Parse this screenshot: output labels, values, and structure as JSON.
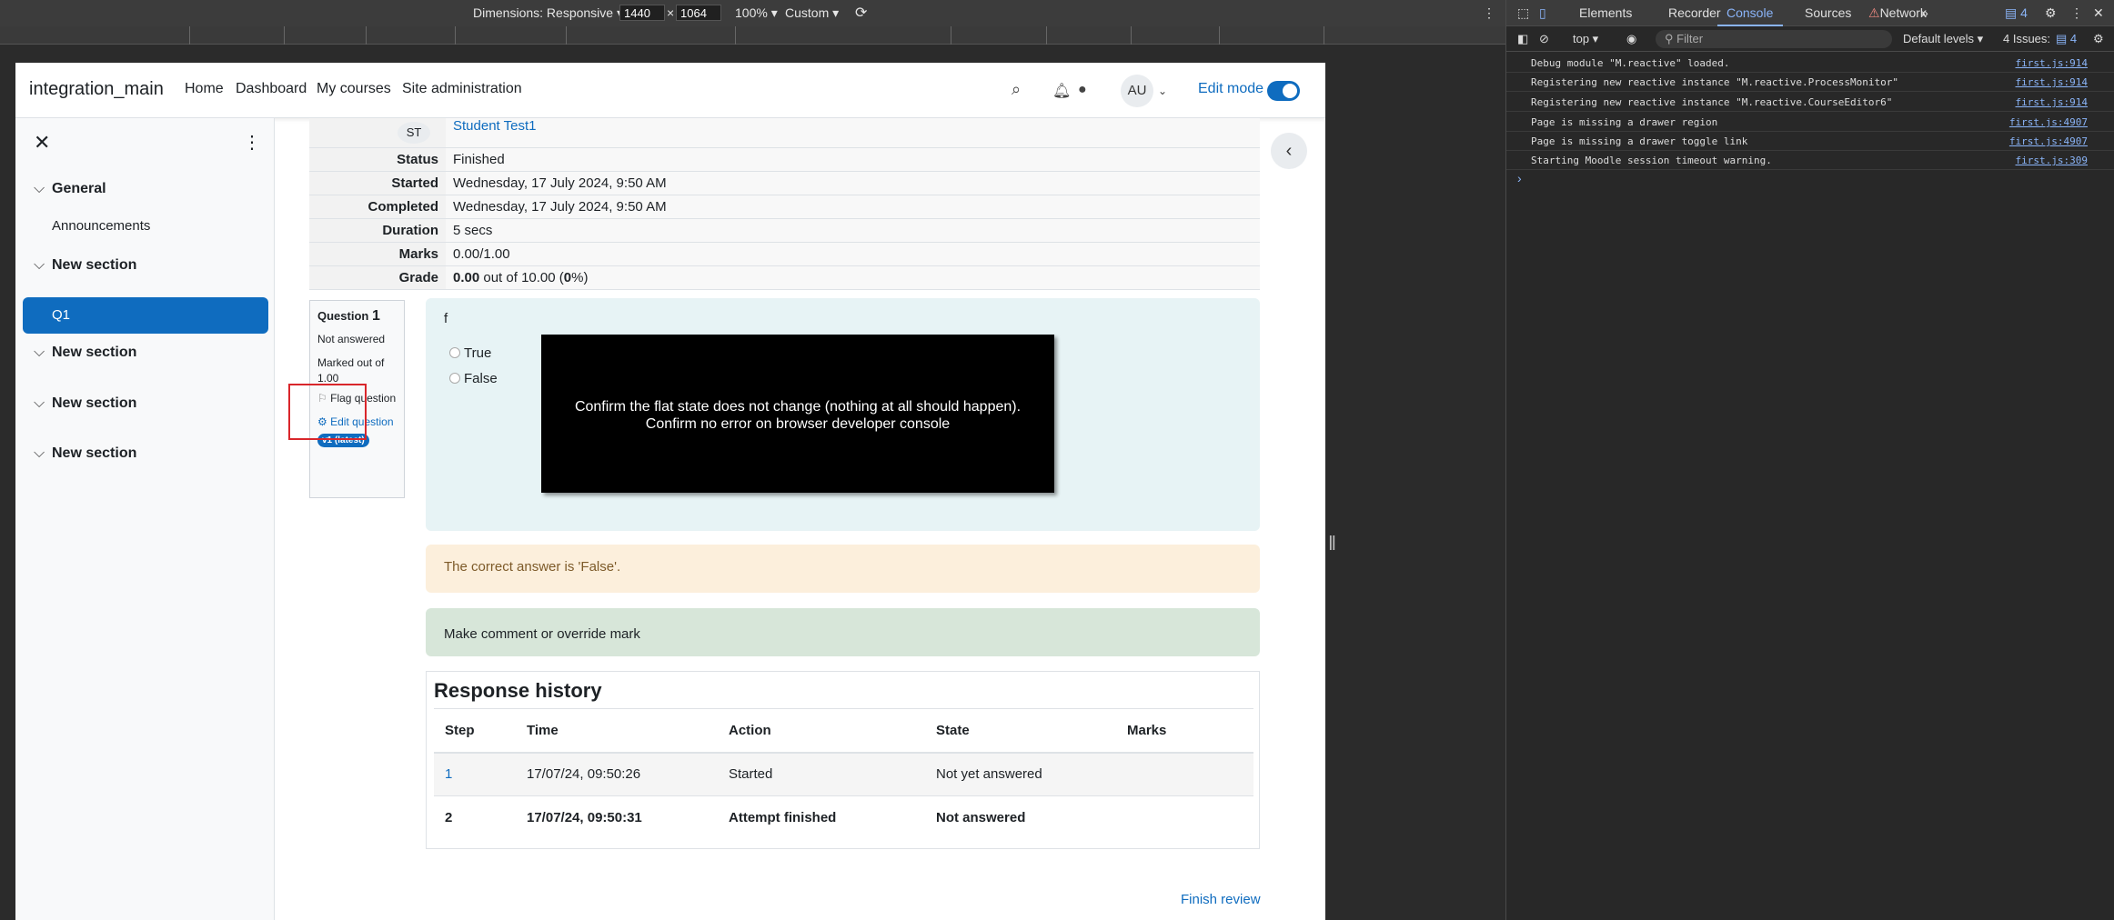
{
  "devtools_device_bar": {
    "dimensions_label": "Dimensions: Responsive ▾",
    "width_value": "1440",
    "times": "×",
    "height_value": "1064",
    "zoom": "100% ▾",
    "throttle": "Custom ▾"
  },
  "navbar": {
    "brand": "integration_main",
    "links": [
      "Home",
      "Dashboard",
      "My courses",
      "Site administration"
    ],
    "avatar_initials": "AU",
    "edit_mode_label": "Edit mode"
  },
  "drawer": {
    "sections": [
      {
        "label": "General",
        "activities": [
          "Announcements"
        ]
      },
      {
        "label": "New section",
        "activities": [
          "Q1"
        ]
      },
      {
        "label": "New section",
        "activities": []
      },
      {
        "label": "New section",
        "activities": []
      },
      {
        "label": "New section",
        "activities": []
      }
    ]
  },
  "summary": {
    "user_initials": "ST",
    "user_name": "Student Test1",
    "rows": [
      {
        "label": "Status",
        "value": "Finished"
      },
      {
        "label": "Started",
        "value": "Wednesday, 17 July 2024, 9:50 AM"
      },
      {
        "label": "Completed",
        "value": "Wednesday, 17 July 2024, 9:50 AM"
      },
      {
        "label": "Duration",
        "value": "5 secs"
      },
      {
        "label": "Marks",
        "value": "0.00/1.00"
      }
    ],
    "grade_label": "Grade",
    "grade_score": "0.00",
    "grade_mid": " out of 10.00 (",
    "grade_percent": "0",
    "grade_end": "%)"
  },
  "question_info": {
    "question_word": "Question",
    "question_number": "1",
    "state": "Not answered",
    "marked_out_of": "Marked out of 1.00",
    "flag_label": "Flag question",
    "edit_label": "Edit question",
    "version_badge": "v1 (latest)"
  },
  "question": {
    "text": "f",
    "options": [
      "True",
      "False"
    ],
    "overlay_line1": "Confirm the flat state does not change (nothing at all should happen).",
    "overlay_line2": "Confirm no error on browser developer console"
  },
  "feedback": "The correct answer is 'False'.",
  "comment_link": "Make comment or override mark",
  "response_history": {
    "title": "Response history",
    "columns": [
      "Step",
      "Time",
      "Action",
      "State",
      "Marks"
    ],
    "rows": [
      {
        "step": "1",
        "time": "17/07/24, 09:50:26",
        "action": "Started",
        "state": "Not yet answered",
        "marks": ""
      },
      {
        "step": "2",
        "time": "17/07/24, 09:50:31",
        "action": "Attempt finished",
        "state": "Not answered",
        "marks": ""
      }
    ]
  },
  "finish_review": "Finish review",
  "devtools": {
    "tabs": [
      "Elements",
      "Recorder",
      "Console",
      "Sources",
      "Network"
    ],
    "active_tab": "Console",
    "issues_badge": "4",
    "context": "top ▾",
    "filter_placeholder": "Filter",
    "levels": "Default levels ▾",
    "issues_label": "4 Issues:",
    "issues_count": "4",
    "logs": [
      {
        "message": "Debug module \"M.reactive\" loaded.",
        "source": "first.js:914"
      },
      {
        "message": "Registering new reactive instance \"M.reactive.ProcessMonitor\"",
        "source": "first.js:914"
      },
      {
        "message": "Registering new reactive instance \"M.reactive.CourseEditor6\"",
        "source": "first.js:914"
      },
      {
        "message": "Page is missing a drawer region",
        "source": "first.js:4907"
      },
      {
        "message": "Page is missing a drawer toggle link",
        "source": "first.js:4907"
      },
      {
        "message": "Starting Moodle session timeout warning.",
        "source": "first.js:309"
      }
    ]
  },
  "colors": {
    "moodle_primary": "#0f6cbf",
    "flag_highlight": "#d9262b",
    "devtools_bg": "#282828",
    "link_blue": "#8ab4f8"
  }
}
